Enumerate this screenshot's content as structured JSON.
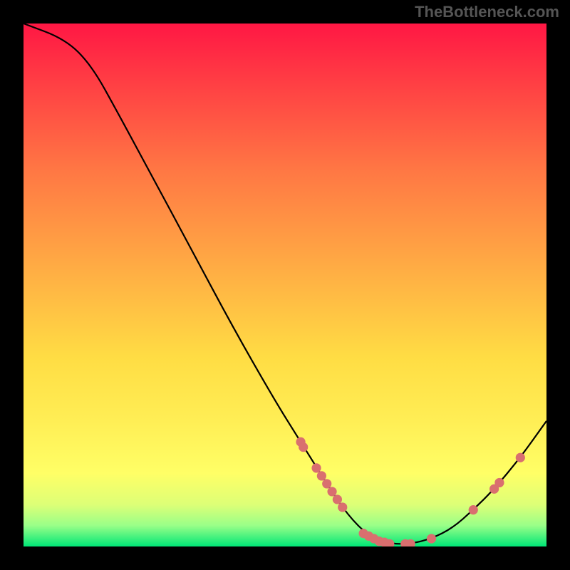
{
  "attribution": "TheBottleneck.com",
  "chart_data": {
    "type": "line",
    "title": "",
    "xlabel": "",
    "ylabel": "",
    "xlim": [
      0,
      100
    ],
    "ylim": [
      0,
      100
    ],
    "curve": [
      {
        "x": 0,
        "y": 100
      },
      {
        "x": 8,
        "y": 97
      },
      {
        "x": 13,
        "y": 92
      },
      {
        "x": 18,
        "y": 83
      },
      {
        "x": 25,
        "y": 70
      },
      {
        "x": 32,
        "y": 57
      },
      {
        "x": 40,
        "y": 42
      },
      {
        "x": 48,
        "y": 28
      },
      {
        "x": 53,
        "y": 20
      },
      {
        "x": 58,
        "y": 12
      },
      {
        "x": 62,
        "y": 6
      },
      {
        "x": 66,
        "y": 2
      },
      {
        "x": 70,
        "y": 0.5
      },
      {
        "x": 74,
        "y": 0.5
      },
      {
        "x": 78,
        "y": 1.5
      },
      {
        "x": 82,
        "y": 3.5
      },
      {
        "x": 86,
        "y": 7
      },
      {
        "x": 90,
        "y": 11
      },
      {
        "x": 95,
        "y": 17
      },
      {
        "x": 100,
        "y": 24
      }
    ],
    "markers": [
      {
        "x": 53,
        "y": 20
      },
      {
        "x": 53.5,
        "y": 19
      },
      {
        "x": 56,
        "y": 15
      },
      {
        "x": 57,
        "y": 13.5
      },
      {
        "x": 58,
        "y": 12
      },
      {
        "x": 59,
        "y": 10.5
      },
      {
        "x": 60,
        "y": 9
      },
      {
        "x": 61,
        "y": 7.5
      },
      {
        "x": 65,
        "y": 2.5
      },
      {
        "x": 66,
        "y": 2
      },
      {
        "x": 67,
        "y": 1.5
      },
      {
        "x": 68,
        "y": 1
      },
      {
        "x": 69,
        "y": 0.8
      },
      {
        "x": 70,
        "y": 0.5
      },
      {
        "x": 73,
        "y": 0.5
      },
      {
        "x": 74,
        "y": 0.5
      },
      {
        "x": 78,
        "y": 1.5
      },
      {
        "x": 86,
        "y": 7
      },
      {
        "x": 90,
        "y": 11
      },
      {
        "x": 91,
        "y": 12.2
      },
      {
        "x": 95,
        "y": 17
      }
    ]
  }
}
